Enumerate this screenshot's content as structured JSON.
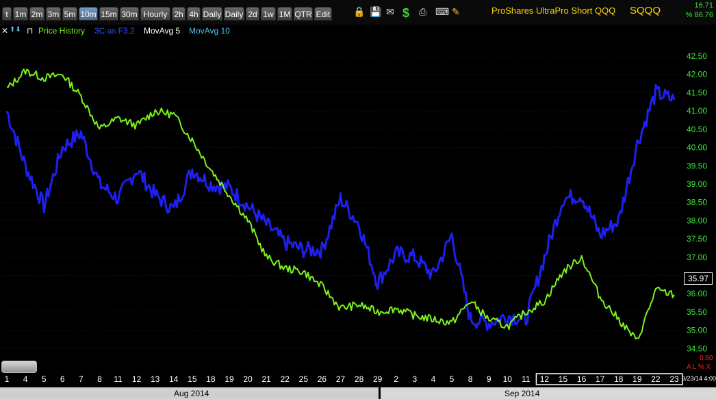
{
  "toolbar": {
    "buttons": [
      "t",
      "1m",
      "2m",
      "3m",
      "5m",
      "10m",
      "15m",
      "30m",
      "Hourly",
      "2h",
      "4h",
      "Daily",
      "Daily",
      "2d",
      "1w",
      "1M",
      "QTR",
      "Edit"
    ],
    "active_index": 5,
    "icons": [
      "lock-icon",
      "save-icon",
      "mail-icon",
      "dollar-icon",
      "printer-icon",
      "keyboard-icon",
      "pencil-icon"
    ]
  },
  "quote": {
    "name": "ProShares UltraPro Short QQQ",
    "symbol": "SQQQ",
    "change": "16.71",
    "pct": "% 86.76"
  },
  "legend": {
    "close_symbol": "✕",
    "arrows": "⬆⬇",
    "pin": "⊓",
    "price_history": "Price History",
    "indicator_3c": "3C as F3.2",
    "movavg5": "MovAvg 5",
    "movavg10": "MovAvg 10"
  },
  "colors": {
    "price": "#7cf51a",
    "indicator": "#1f1ff0",
    "axis_text": "#39e639",
    "grid": "#444444",
    "movavg10": "#4fc3f7",
    "indicator_legend": "#3a4bff"
  },
  "last_price": "35.97",
  "corner": {
    "value": "0.60",
    "flags": "A L % X"
  },
  "timestamp": "9/23/14 4:00",
  "months": {
    "aug": "Aug 2014",
    "sep": "Sep 2014"
  },
  "chart_data": {
    "type": "line",
    "ylim": [
      34.0,
      42.8
    ],
    "y_ticks": [
      "42.50",
      "42.00",
      "41.50",
      "41.00",
      "40.50",
      "40.00",
      "39.50",
      "39.00",
      "38.50",
      "38.00",
      "37.50",
      "37.00",
      "36.50",
      "36.00",
      "35.50",
      "35.00",
      "34.50"
    ],
    "x_labels": [
      "1",
      "4",
      "5",
      "6",
      "7",
      "8",
      "11",
      "12",
      "13",
      "14",
      "15",
      "18",
      "19",
      "20",
      "21",
      "22",
      "25",
      "26",
      "27",
      "28",
      "29",
      "2",
      "3",
      "4",
      "5",
      "8",
      "9",
      "10",
      "11",
      "12",
      "15",
      "16",
      "17",
      "18",
      "19",
      "22",
      "23"
    ],
    "series": [
      {
        "name": "Price History",
        "values": [
          41.6,
          42.1,
          41.9,
          42.0,
          41.4,
          40.5,
          40.8,
          40.6,
          41.0,
          40.9,
          40.2,
          39.4,
          38.7,
          38.0,
          37.0,
          36.7,
          36.6,
          36.2,
          35.6,
          35.7,
          35.5,
          35.6,
          35.4,
          35.3,
          35.2,
          35.8,
          35.3,
          35.1,
          35.5,
          35.8,
          36.6,
          37.0,
          35.9,
          35.3,
          34.7,
          36.1,
          35.97
        ]
      },
      {
        "name": "3C as F3.2",
        "values": [
          41.0,
          39.5,
          38.4,
          40.0,
          40.4,
          39.0,
          38.6,
          39.4,
          38.7,
          38.3,
          39.4,
          39.0,
          38.9,
          38.4,
          37.9,
          37.4,
          37.2,
          37.2,
          38.6,
          37.9,
          36.3,
          37.1,
          37.0,
          36.5,
          37.6,
          35.3,
          35.2,
          35.4,
          35.3,
          37.0,
          38.6,
          38.7,
          37.6,
          38.0,
          40.1,
          41.5,
          41.3
        ]
      }
    ]
  }
}
